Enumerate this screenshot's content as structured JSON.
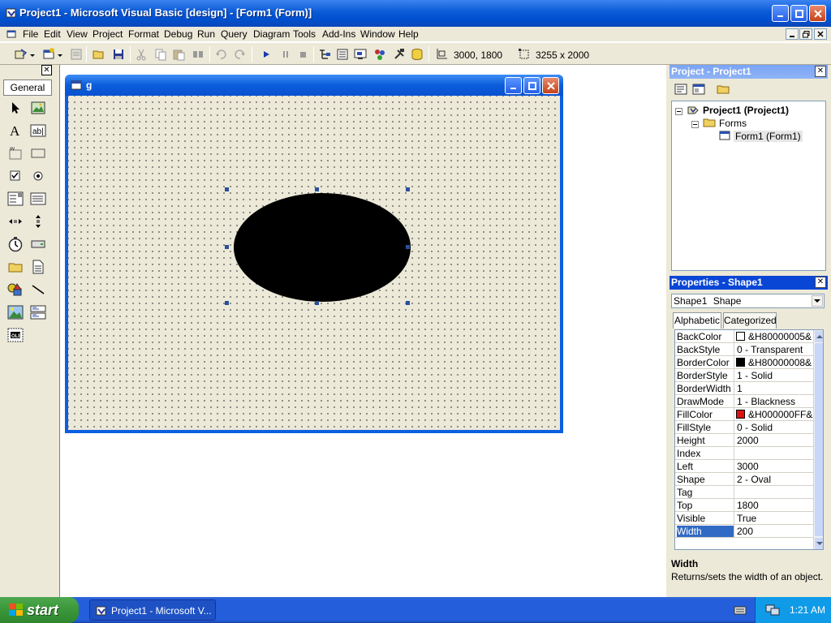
{
  "window": {
    "title": "Project1 - Microsoft Visual Basic [design] - [Form1 (Form)]"
  },
  "menu": [
    "File",
    "Edit",
    "View",
    "Project",
    "Format",
    "Debug",
    "Run",
    "Query",
    "Diagram",
    "Tools",
    "Add-Ins",
    "Window",
    "Help"
  ],
  "toolbar": {
    "position_readout": "3000, 1800",
    "size_readout": "3255 x 2000"
  },
  "toolbox": {
    "tab_label": "General",
    "close_label": "✕"
  },
  "form": {
    "caption": "g"
  },
  "project_panel": {
    "title": "Project - Project1",
    "close_label": "✕",
    "tree": {
      "root": "Project1 (Project1)",
      "folder": "Forms",
      "item": "Form1 (Form1)"
    }
  },
  "properties_panel": {
    "title": "Properties - Shape1",
    "close_label": "✕",
    "object_name": "Shape1",
    "object_type": "Shape",
    "tabs": [
      "Alphabetic",
      "Categorized"
    ],
    "properties": [
      {
        "name": "BackColor",
        "value": "&H80000005&",
        "swatch": "#ffffff"
      },
      {
        "name": "BackStyle",
        "value": "0 - Transparent"
      },
      {
        "name": "BorderColor",
        "value": "&H80000008&",
        "swatch": "#000000"
      },
      {
        "name": "BorderStyle",
        "value": "1 - Solid"
      },
      {
        "name": "BorderWidth",
        "value": "1"
      },
      {
        "name": "DrawMode",
        "value": "1 - Blackness"
      },
      {
        "name": "FillColor",
        "value": "&H000000FF&",
        "swatch": "#e01010"
      },
      {
        "name": "FillStyle",
        "value": "0 - Solid"
      },
      {
        "name": "Height",
        "value": "2000"
      },
      {
        "name": "Index",
        "value": ""
      },
      {
        "name": "Left",
        "value": "3000"
      },
      {
        "name": "Shape",
        "value": "2 - Oval"
      },
      {
        "name": "Tag",
        "value": ""
      },
      {
        "name": "Top",
        "value": "1800"
      },
      {
        "name": "Visible",
        "value": "True"
      },
      {
        "name": "Width",
        "value": "200"
      }
    ],
    "selected_property": "Width",
    "description_title": "Width",
    "description_text": "Returns/sets the width of an object."
  },
  "taskbar": {
    "start_label": "start",
    "task_label": "Project1 - Microsoft V...",
    "clock": "1:21 AM"
  },
  "colors": {
    "selection": "#316ac5",
    "titlebar": "#0a5ad6",
    "shape_fill": "#000000"
  }
}
